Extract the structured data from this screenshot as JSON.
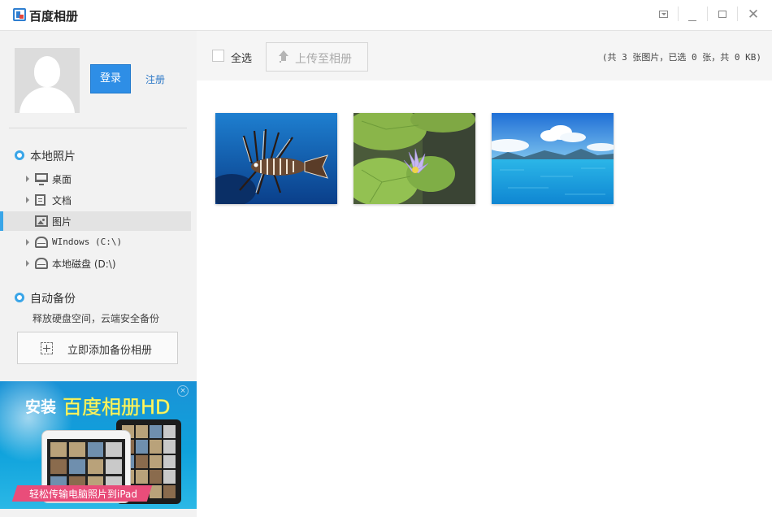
{
  "window": {
    "title": "百度相册",
    "controls": [
      "menu",
      "minimize",
      "maximize",
      "close"
    ]
  },
  "account": {
    "login_label": "登录",
    "register_label": "注册"
  },
  "local_photos": {
    "title": "本地照片",
    "items": [
      {
        "label": "桌面",
        "icon": "monitor-icon",
        "expandable": true,
        "selected": false
      },
      {
        "label": "文档",
        "icon": "document-icon",
        "expandable": true,
        "selected": false
      },
      {
        "label": "图片",
        "icon": "picture-icon",
        "expandable": false,
        "selected": true
      },
      {
        "label": "WIndows (C:\\)",
        "icon": "drive-icon",
        "expandable": true,
        "selected": false
      },
      {
        "label": "本地磁盘 (D:\\)",
        "icon": "drive-icon",
        "expandable": true,
        "selected": false
      }
    ]
  },
  "auto_backup": {
    "title": "自动备份",
    "description": "释放硬盘空间，云端安全备份",
    "add_button_label": "立即添加备份相册"
  },
  "ad": {
    "title_prefix": "安装",
    "title_main": "百度相册HD",
    "ribbon_text": "轻松传输电脑照片到iPad",
    "close_symbol": "×"
  },
  "toolbar": {
    "select_all_label": "全选",
    "select_all_checked": false,
    "upload_label": "上传至相册",
    "upload_enabled": false,
    "summary": "(共 3 张图片，已选 0 张，共 0 KB)"
  },
  "photos": [
    {
      "subject": "lionfish"
    },
    {
      "subject": "water-lily"
    },
    {
      "subject": "ocean"
    }
  ],
  "colors": {
    "accent": "#39a5e8",
    "login_button": "#2e8ee6",
    "link": "#2e79c7",
    "sidebar_bg": "#f2f2f2",
    "ad_ribbon": "#e94d7a"
  }
}
